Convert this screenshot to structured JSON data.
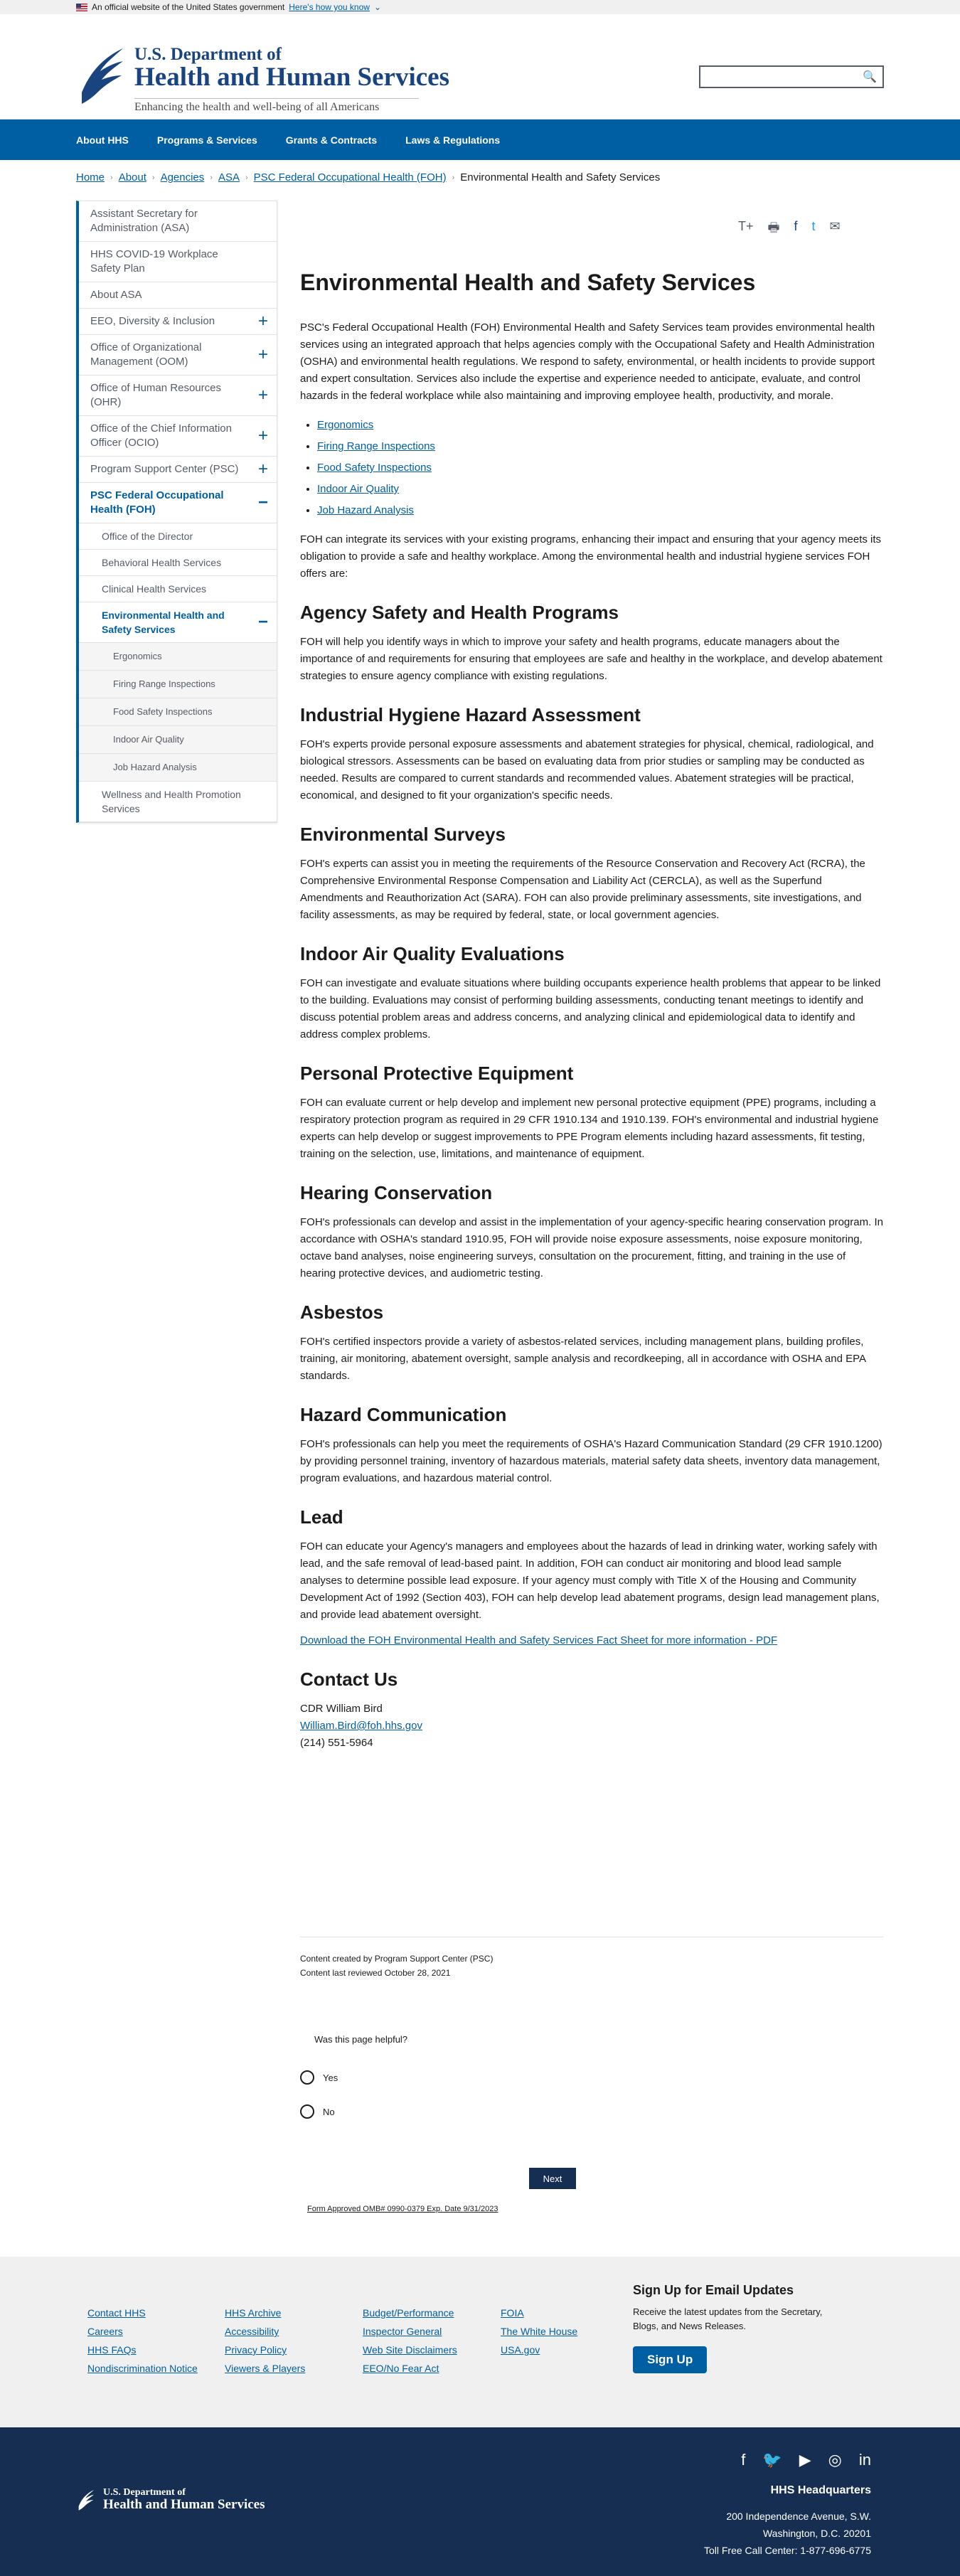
{
  "banner": {
    "text": "An official website of the United States government",
    "link": "Here's how you know"
  },
  "header": {
    "logo_line1": "U.S. Department of",
    "logo_line2": "Health and Human Services",
    "tagline": "Enhancing the health and well-being of all Americans",
    "search_icon": "search-icon"
  },
  "nav": [
    "About HHS",
    "Programs & Services",
    "Grants & Contracts",
    "Laws & Regulations"
  ],
  "breadcrumb": [
    "Home",
    "About",
    "Agencies",
    "ASA",
    "PSC Federal Occupational Health (FOH)",
    "Environmental Health and Safety Services"
  ],
  "sidebar": [
    {
      "label": "Assistant Secretary for Administration (ASA)",
      "level": 1,
      "exp": ""
    },
    {
      "label": "HHS COVID-19 Workplace Safety Plan",
      "level": 1,
      "exp": ""
    },
    {
      "label": "About ASA",
      "level": 1,
      "exp": ""
    },
    {
      "label": "EEO, Diversity & Inclusion",
      "level": 1,
      "exp": "plus"
    },
    {
      "label": "Office of Organizational Management (OOM)",
      "level": 1,
      "exp": "plus"
    },
    {
      "label": "Office of Human Resources (OHR)",
      "level": 1,
      "exp": "plus"
    },
    {
      "label": "Office of the Chief Information Officer (OCIO)",
      "level": 1,
      "exp": "plus"
    },
    {
      "label": "Program Support Center (PSC)",
      "level": 1,
      "exp": "plus"
    },
    {
      "label": "PSC Federal Occupational Health (FOH)",
      "level": 1,
      "exp": "minus",
      "active": true
    },
    {
      "label": "Office of the Director",
      "level": 2,
      "exp": ""
    },
    {
      "label": "Behavioral Health Services",
      "level": 2,
      "exp": ""
    },
    {
      "label": "Clinical Health Services",
      "level": 2,
      "exp": ""
    },
    {
      "label": "Environmental Health and Safety Services",
      "level": 2,
      "exp": "minus",
      "active": true
    },
    {
      "label": "Ergonomics",
      "level": 3,
      "exp": ""
    },
    {
      "label": "Firing Range Inspections",
      "level": 3,
      "exp": ""
    },
    {
      "label": "Food Safety Inspections",
      "level": 3,
      "exp": ""
    },
    {
      "label": "Indoor Air Quality",
      "level": 3,
      "exp": ""
    },
    {
      "label": "Job Hazard Analysis",
      "level": 3,
      "exp": ""
    },
    {
      "label": "Wellness and Health Promotion Services",
      "level": 2,
      "exp": ""
    }
  ],
  "share": {
    "text_size": "T+",
    "print": "🖶",
    "facebook": "f",
    "twitter": "t",
    "email": "✉"
  },
  "main": {
    "title": "Environmental Health and Safety Services",
    "intro": "PSC's Federal Occupational Health (FOH) Environmental Health and Safety Services team provides environmental health services using an integrated approach that helps agencies comply with the Occupational Safety and Health Administration (OSHA) and environmental health regulations. We respond to safety, environmental, or health incidents to provide support and expert consultation. Services also include the expertise and experience needed to anticipate, evaluate, and control hazards in the federal workplace while also maintaining and improving employee health, productivity, and morale.",
    "links": [
      "Ergonomics",
      "Firing Range Inspections",
      "Food Safety Inspections",
      "Indoor Air Quality",
      "Job Hazard Analysis"
    ],
    "intro2": "FOH can integrate its services with your existing programs, enhancing their impact and ensuring that your agency meets its obligation to provide a safe and healthy workplace. Among the environmental health and industrial hygiene services FOH offers are:",
    "sections": [
      {
        "h": "Agency Safety and Health Programs",
        "p": "FOH will help you identify ways in which to improve your safety and health programs, educate managers about the importance of and requirements for ensuring that employees are safe and healthy in the workplace, and develop abatement strategies to ensure agency compliance with existing regulations."
      },
      {
        "h": "Industrial Hygiene Hazard Assessment",
        "p": "FOH's experts provide personal exposure assessments and abatement strategies for physical, chemical, radiological, and biological stressors. Assessments can be based on evaluating data from prior studies or sampling may be conducted as needed. Results are compared to current standards and recommended values. Abatement strategies will be practical, economical, and designed to fit your organization's specific needs."
      },
      {
        "h": "Environmental Surveys",
        "p": "FOH's experts can assist you in meeting the requirements of the Resource Conservation and Recovery Act (RCRA), the Comprehensive Environmental Response Compensation and Liability Act (CERCLA), as well as the Superfund Amendments and Reauthorization Act (SARA). FOH can also provide preliminary assessments, site investigations, and facility assessments, as may be required by federal, state, or local government agencies."
      },
      {
        "h": "Indoor Air Quality Evaluations",
        "p": "FOH can investigate and evaluate situations where building occupants experience health problems that appear to be linked to the building. Evaluations may consist of performing building assessments, conducting tenant meetings to identify and discuss potential problem areas and address concerns, and analyzing clinical and epidemiological data to identify and address complex problems."
      },
      {
        "h": "Personal Protective Equipment",
        "p": "FOH can evaluate current or help develop and implement new personal protective equipment (PPE) programs, including a respiratory protection program as required in 29 CFR 1910.134 and 1910.139. FOH's environmental and industrial hygiene experts can help develop or suggest improvements to PPE Program elements including hazard assessments, fit testing, training on the selection, use, limitations, and maintenance of equipment."
      },
      {
        "h": "Hearing Conservation",
        "p": "FOH's professionals can develop and assist in the implementation of your agency-specific hearing conservation program. In accordance with OSHA's standard 1910.95, FOH will provide noise exposure assessments, noise exposure monitoring, octave band analyses, noise engineering surveys, consultation on the procurement, fitting, and training in the use of hearing protective devices, and audiometric testing."
      },
      {
        "h": "Asbestos",
        "p": "FOH's certified inspectors provide a variety of asbestos-related services, including management plans, building profiles, training, air monitoring, abatement oversight, sample analysis and recordkeeping, all in accordance with OSHA and EPA standards."
      },
      {
        "h": "Hazard Communication",
        "p": "FOH's professionals can help you meet the requirements of OSHA's Hazard Communication Standard (29 CFR 1910.1200) by providing personnel training, inventory of hazardous materials, material safety data sheets, inventory data management, program evaluations, and hazardous material control."
      },
      {
        "h": "Lead",
        "p": "FOH can educate your Agency's managers and employees about the hazards of lead in drinking water, working safely with lead, and the safe removal of lead-based paint. In addition, FOH can conduct air monitoring and blood lead sample analyses to determine possible lead exposure. If your agency must comply with Title X of the Housing and Community Development Act of 1992 (Section 403), FOH can help develop lead abatement programs, design lead management plans, and provide lead abatement oversight."
      }
    ],
    "pdf_link": "Download the FOH Environmental Health and Safety Services Fact Sheet for more information - PDF",
    "contact_title": "Contact Us",
    "contact_name": "CDR William Bird",
    "contact_email": "William.Bird@foh.hhs.gov",
    "contact_phone": "(214) 551-5964"
  },
  "meta": {
    "created": "Content created by Program Support Center (PSC)",
    "reviewed": "Content last reviewed October 28, 2021"
  },
  "feedback": {
    "question": "Was this page helpful?",
    "yes": "Yes",
    "no": "No",
    "next": "Next",
    "omb": "Form Approved OMB# 0990-0379 Exp. Date 9/31/2023"
  },
  "footer": {
    "col1": [
      "Contact HHS",
      "Careers",
      "HHS FAQs",
      "Nondiscrimination Notice"
    ],
    "col2": [
      "HHS Archive",
      "Accessibility",
      "Privacy Policy",
      "Viewers & Players"
    ],
    "col3": [
      "Budget/Performance",
      "Inspector General",
      "Web Site Disclaimers",
      "EEO/No Fear Act"
    ],
    "col4": [
      "FOIA",
      "The White House",
      "USA.gov"
    ],
    "signup_title": "Sign Up for Email Updates",
    "signup_text": "Receive the latest updates from the Secretary, Blogs, and News Releases.",
    "signup_button": "Sign Up",
    "logo_line1": "U.S. Department of",
    "logo_line2": "Health and Human Services",
    "hq_title": "HHS Headquarters",
    "hq_addr1": "200 Independence Avenue, S.W.",
    "hq_addr2": "Washington, D.C. 20201",
    "hq_phone": "Toll Free Call Center: 1-877-696-6775"
  }
}
